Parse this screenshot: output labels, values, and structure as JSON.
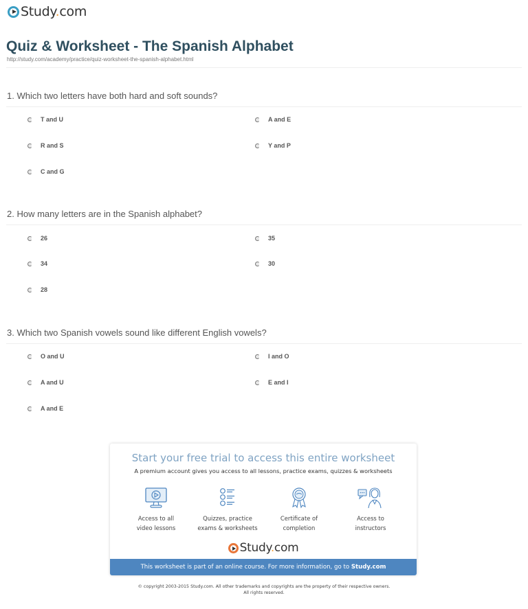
{
  "header": {
    "logo_text_main": "Study",
    "logo_text_dot": ".",
    "logo_text_tld": "com",
    "title": "Quiz & Worksheet - The Spanish Alphabet",
    "url": "http://study.com/academy/practice/quiz-worksheet-the-spanish-alphabet.html"
  },
  "questions": [
    {
      "text": "1. Which two letters have both hard and soft sounds?",
      "options": [
        "T and U",
        "A and E",
        "R and S",
        "Y and P",
        "C and G"
      ]
    },
    {
      "text": "2. How many letters are in the Spanish alphabet?",
      "options": [
        "26",
        "35",
        "34",
        "30",
        "28"
      ]
    },
    {
      "text": "3. Which two Spanish vowels sound like different English vowels?",
      "options": [
        "O and U",
        "I and O",
        "A and U",
        "E and I",
        "A and E"
      ]
    }
  ],
  "promo": {
    "title": "Start your free trial to access this entire worksheet",
    "subtitle": "A premium account gives you access to all lessons, practice exams, quizzes & worksheets",
    "features": [
      {
        "icon": "video-monitor-icon",
        "line1": "Access to all",
        "line2": "video lessons"
      },
      {
        "icon": "quiz-list-icon",
        "line1": "Quizzes, practice",
        "line2": "exams & worksheets"
      },
      {
        "icon": "certificate-ribbon-icon",
        "line1": "Certificate of",
        "line2": "completion"
      },
      {
        "icon": "instructor-chat-icon",
        "line1": "Access to",
        "line2": "instructors"
      }
    ],
    "bar_text": "This worksheet is part of an online course. For more information, go to ",
    "bar_link": "Study.com"
  },
  "footer": {
    "copyright_line1": "© copyright 2003-2015 Study.com. All other trademarks and copyrights are the property of their respective owners.",
    "copyright_line2": "All rights reserved."
  },
  "colors": {
    "title": "#2f4f5f",
    "accent_blue": "#4e86c0",
    "promo_title": "#7fa3c3",
    "logo_orange": "#f2a03d"
  }
}
